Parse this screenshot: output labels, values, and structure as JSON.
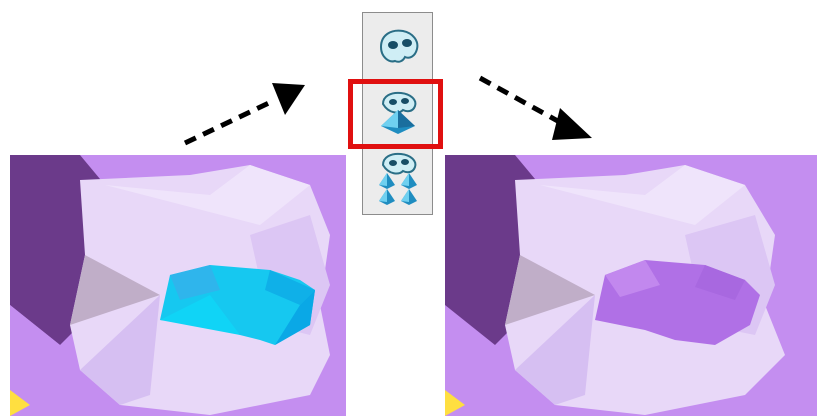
{
  "toolbar": {
    "buttons": [
      {
        "icon": "mask-icon",
        "selected": false
      },
      {
        "icon": "mask-pyramid-icon",
        "selected": true
      },
      {
        "icon": "mask-multi-pyramid-icon",
        "selected": false
      }
    ],
    "highlight_color": "#e01010"
  },
  "panels": {
    "before": {
      "selection_color": "#16c8f0",
      "surface_color": "#c48ef0"
    },
    "after": {
      "selection_color": "#b070e6",
      "surface_color": "#c48ef0"
    }
  },
  "arrows": {
    "style": "dashed",
    "color": "#000000"
  }
}
